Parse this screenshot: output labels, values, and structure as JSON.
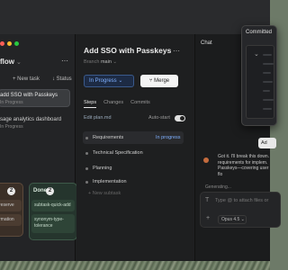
{
  "colors": {
    "accent_blue": "#7fb0ff",
    "done_green": "#25352d",
    "brown_col": "#3a2f27",
    "window_dots": [
      "#ff5f57",
      "#febc2e",
      "#28c840"
    ]
  },
  "left": {
    "title": "flow",
    "more": "⋯",
    "new_task": "+ New task",
    "status": "↓ Status",
    "tasks": [
      {
        "title": "add SSO with Passkeys",
        "sub": "In Progress"
      },
      {
        "title": "sage analytics dashboard",
        "sub": "In Progress"
      }
    ],
    "kanban": {
      "col1_count": "2",
      "col1_cards": [
        "reserve",
        "rmation"
      ],
      "done_label": "Done",
      "done_count": "2",
      "done_cards": [
        "subtask-quick-add",
        "synonym-type-tolerance"
      ]
    }
  },
  "mid": {
    "title": "Add SSO with Passkeys",
    "branch_label": "Branch",
    "branch": "main",
    "more": "⋯",
    "status_button": "In Progress",
    "merge_button": "Merge",
    "tabs": [
      "Steps",
      "Changes",
      "Commits"
    ],
    "edit_plan": "Edit plan.md",
    "auto_start": "Auto-start",
    "plan": [
      {
        "label": "Requirements",
        "status": "In progress"
      },
      {
        "label": "Technical Specification"
      },
      {
        "label": "Planning"
      },
      {
        "label": "Implementation"
      }
    ],
    "new_subtask": "+ New subtask"
  },
  "chat": {
    "title": "Chat",
    "bubble": "Ad",
    "message": "Got it. I'll break this down. requirements for implem. Passkeys—covering user flo",
    "generating": "Generating...",
    "input_placeholder": "Type  @ to attach files or",
    "model": "Opus 4.5 ⌄",
    "plus": "+"
  },
  "popover": {
    "title": "Committed"
  }
}
